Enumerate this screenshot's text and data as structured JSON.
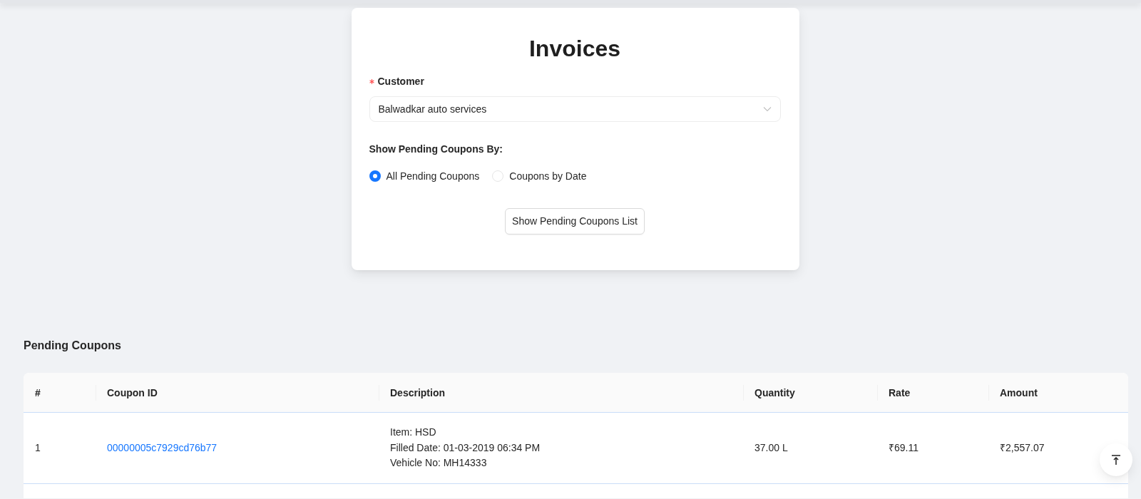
{
  "page": {
    "title": "Invoices"
  },
  "form": {
    "customer_label": "Customer",
    "required": true,
    "customer_value": "Balwadkar auto services",
    "filter_label": "Show Pending Coupons By:",
    "options": [
      {
        "label": "All Pending Coupons",
        "selected": true
      },
      {
        "label": "Coupons by Date",
        "selected": false
      }
    ],
    "submit_button": "Show Pending Coupons List"
  },
  "pending": {
    "heading": "Pending Coupons",
    "columns": [
      "#",
      "Coupon ID",
      "Description",
      "Quantity",
      "Rate",
      "Amount"
    ],
    "rows": [
      {
        "index": "1",
        "coupon_id": "00000005c7929cd76b77",
        "description": [
          "Item: HSD",
          "Filled Date: 01-03-2019 06:34 PM",
          "Vehicle No: MH14333"
        ],
        "quantity": "37.00 L",
        "rate": "₹69.11",
        "amount": "₹2,557.07"
      }
    ]
  }
}
